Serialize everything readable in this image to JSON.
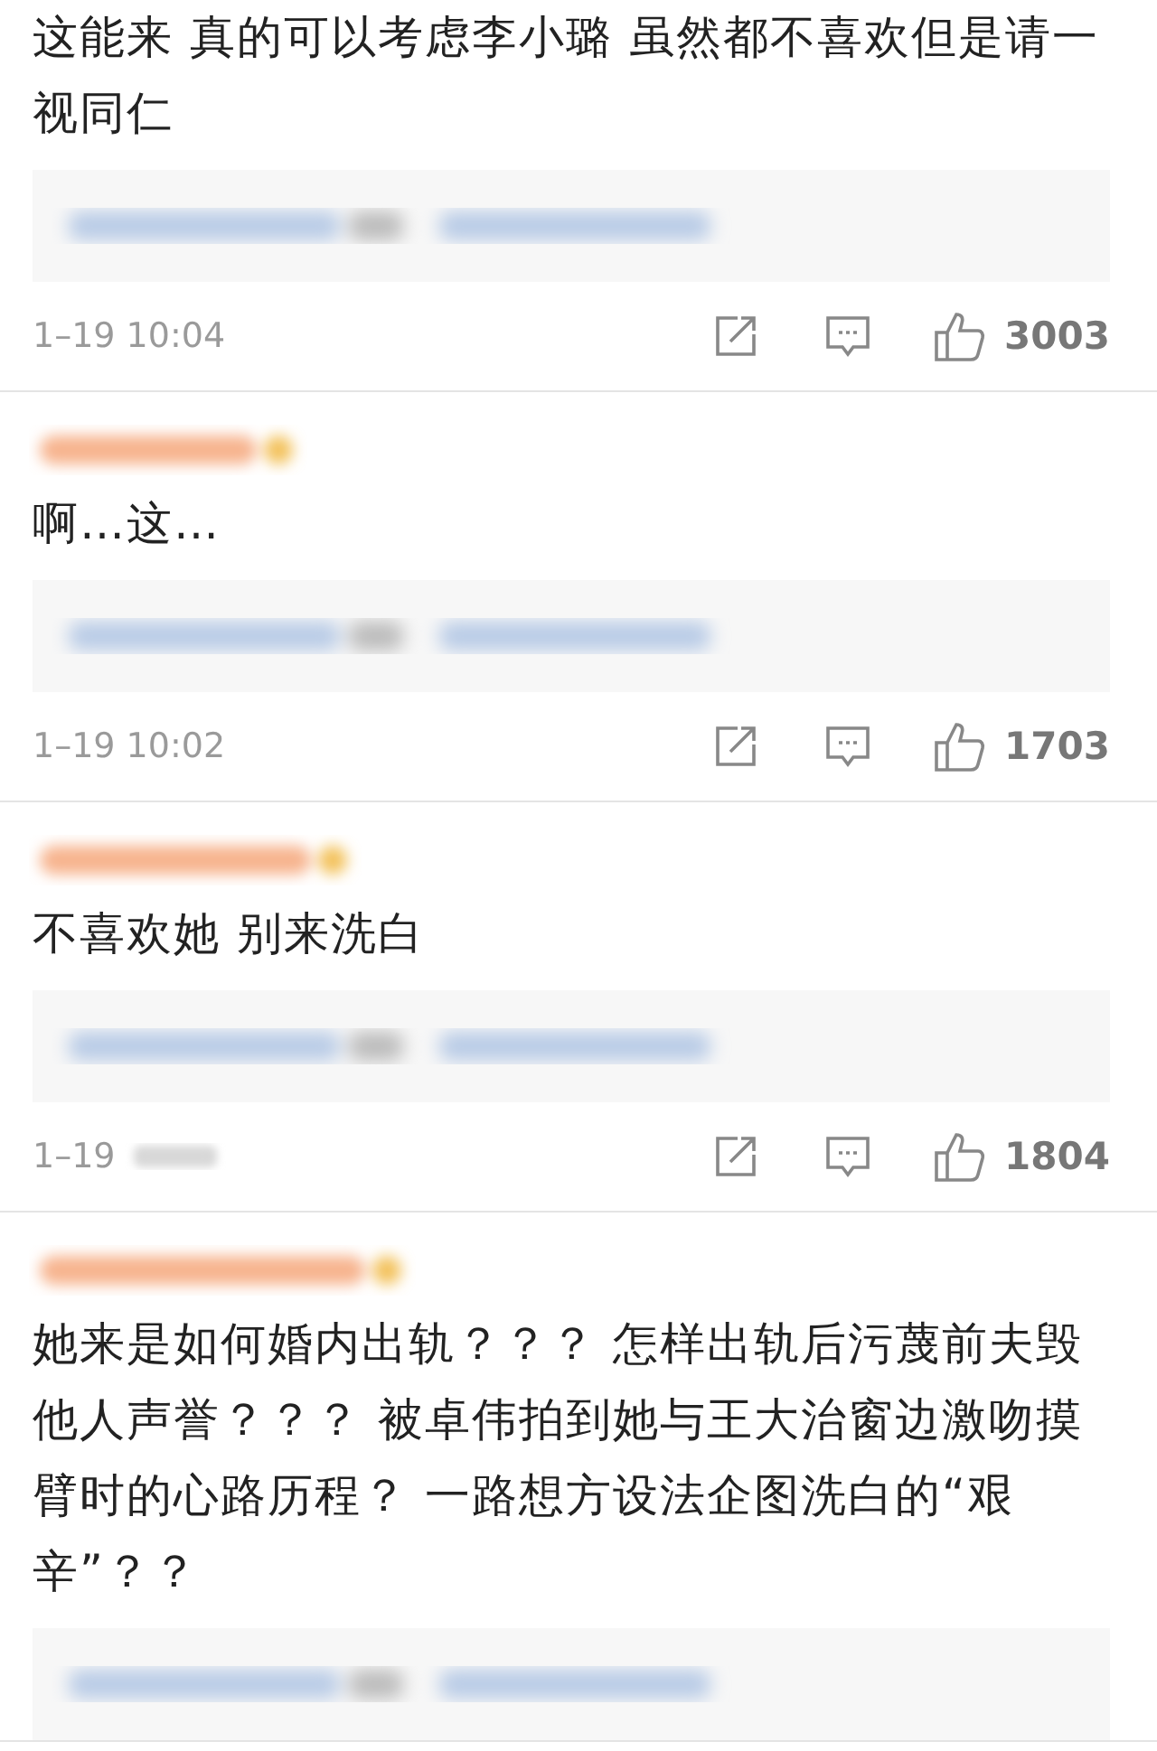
{
  "comments": [
    {
      "has_username": false,
      "text": "这能来 真的可以考虑李小璐 虽然都不喜欢但是请一视同仁",
      "has_reply_preview": true,
      "footer": {
        "time": "1–19 10:04",
        "time_obscured": false,
        "likes": "3003"
      }
    },
    {
      "has_username": true,
      "text": "啊…这…",
      "has_reply_preview": true,
      "footer": {
        "time": "1–19 10:02",
        "time_obscured": false,
        "likes": "1703"
      }
    },
    {
      "has_username": true,
      "text": "不喜欢她 别来洗白",
      "has_reply_preview": true,
      "footer": {
        "time": "1–19",
        "time_obscured": true,
        "likes": "1804"
      }
    },
    {
      "has_username": true,
      "text": "她来是如何婚内出轨？？？ 怎样出轨后污蔑前夫毁他人声誉？？？ 被卓伟拍到她与王大治窗边激吻摸臂时的心路历程？ 一路想方设法企图洗白的“艰辛”？？",
      "has_reply_preview": true
    }
  ]
}
